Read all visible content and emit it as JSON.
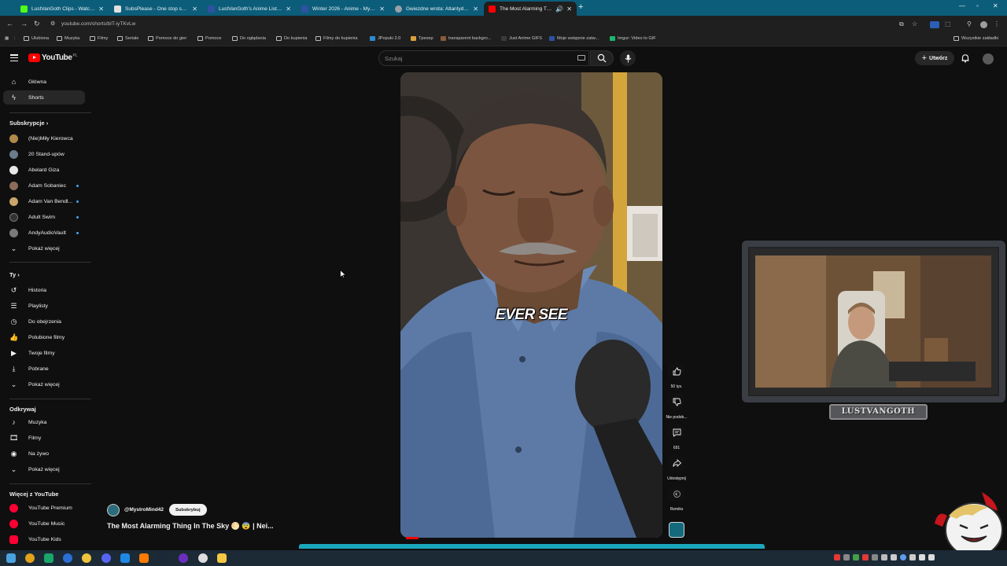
{
  "browser": {
    "tabs": [
      {
        "title": "LustVanGoth Clips - Watch Live",
        "favicon_color": "#53fc18"
      },
      {
        "title": "SubsPlease - One stop shop fo",
        "favicon_color": "#e0e0e0"
      },
      {
        "title": "LustVanGoth's Anime List - My",
        "favicon_color": "#2e51a2"
      },
      {
        "title": "Winter 2026 - Anime - MyAnim",
        "favicon_color": "#2e51a2"
      },
      {
        "title": "Gwiezdne wrota: Atlantyda / St",
        "favicon_color": "#9aa0a6"
      },
      {
        "title": "The Most Alarming Thing In",
        "favicon_color": "#ff0000"
      }
    ],
    "url": "youtube.com/shorts/bIT-iyTKvLw",
    "bookmarks": [
      {
        "label": "Ulubiona",
        "icon": "folder-icon"
      },
      {
        "label": "Muzyka",
        "icon": "folder-icon"
      },
      {
        "label": "Filmy",
        "icon": "folder-icon"
      },
      {
        "label": "Seriale",
        "icon": "folder-icon"
      },
      {
        "label": "Pomoce do gier",
        "icon": "folder-icon"
      },
      {
        "label": "Pomoce",
        "icon": "folder-icon"
      },
      {
        "label": "Do oglądania",
        "icon": "folder-icon"
      },
      {
        "label": "Do kupienia",
        "icon": "folder-icon"
      },
      {
        "label": "Filmy do kupienia",
        "icon": "folder-icon"
      },
      {
        "label": "JPopuki 2.0",
        "icon": "site-icon"
      },
      {
        "label": "Tpexep",
        "icon": "site-icon"
      },
      {
        "label": "transparent backgro...",
        "icon": "site-icon"
      },
      {
        "label": "Just Anime GIFS",
        "icon": "site-icon"
      },
      {
        "label": "Moje wstępnie zatw...",
        "icon": "site-icon"
      },
      {
        "label": "Imgur: Video to GIF",
        "icon": "site-icon"
      }
    ],
    "all_bookmarks": "Wszystkie zakładki"
  },
  "header": {
    "logo": "YouTube",
    "country": "PL",
    "search_placeholder": "Szukaj",
    "create_label": "Utwórz"
  },
  "sidebar": {
    "main": [
      {
        "label": "Główna",
        "icon": "home-icon"
      },
      {
        "label": "Shorts",
        "icon": "shorts-icon",
        "active": true
      }
    ],
    "subscriptions_title": "Subskrypcje",
    "subscriptions": [
      {
        "label": "(Nie)Miły Kierowca",
        "color": "#b08a4a",
        "new": false
      },
      {
        "label": "20 Stand-upów",
        "color": "#6a7b8c",
        "new": false
      },
      {
        "label": "Abelard Giza",
        "color": "#e8e8e8",
        "new": false
      },
      {
        "label": "Adam Sobaniec",
        "color": "#8c6b5a",
        "new": true
      },
      {
        "label": "Adam Van Bendl...",
        "color": "#c9a56b",
        "new": true
      },
      {
        "label": "Adult Swim",
        "color": "#333333",
        "new": true
      },
      {
        "label": "AndyAudioVault",
        "color": "#7a7a7a",
        "new": true
      }
    ],
    "show_more": "Pokaż więcej",
    "you_title": "Ty",
    "you": [
      {
        "label": "Historia",
        "icon": "history-icon"
      },
      {
        "label": "Playlisty",
        "icon": "playlist-icon"
      },
      {
        "label": "Do obejrzenia",
        "icon": "clock-icon"
      },
      {
        "label": "Polubione filmy",
        "icon": "like-icon"
      },
      {
        "label": "Twoje filmy",
        "icon": "video-icon"
      },
      {
        "label": "Pobrane",
        "icon": "download-icon"
      },
      {
        "label": "Pokaż więcej",
        "icon": "chevron-down-icon"
      }
    ],
    "explore_title": "Odkrywaj",
    "explore": [
      {
        "label": "Muzyka",
        "icon": "music-icon"
      },
      {
        "label": "Filmy",
        "icon": "film-icon"
      },
      {
        "label": "Na żywo",
        "icon": "live-icon"
      },
      {
        "label": "Pokaż więcej",
        "icon": "chevron-down-icon"
      }
    ],
    "more_title": "Więcej z YouTube",
    "more": [
      {
        "label": "YouTube Premium"
      },
      {
        "label": "YouTube Music"
      },
      {
        "label": "YouTube Kids"
      }
    ]
  },
  "short": {
    "caption": "EVER SEE",
    "channel": "@MystroMind42",
    "subscribe": "Subskrybuj",
    "title": "The Most Alarming Thing In The Sky 🌕 😨 | Nei...",
    "actions": {
      "likes": "50 tys.",
      "dislike": "Nie podob...",
      "comments": "691",
      "share": "Udostępnij",
      "remix": "Remiks"
    }
  },
  "overlay": {
    "streamer_name": "LUSTVANGOTH"
  }
}
